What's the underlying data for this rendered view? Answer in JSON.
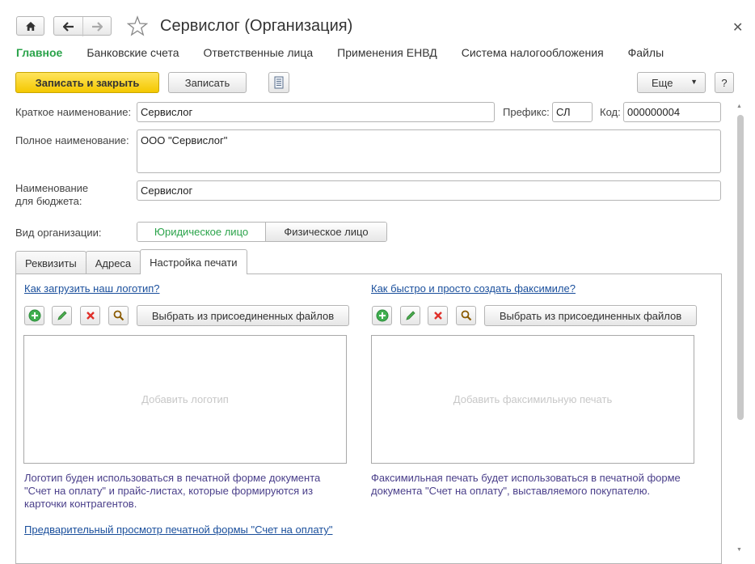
{
  "window": {
    "title": "Сервислог (Организация)"
  },
  "sections": [
    {
      "label": "Главное",
      "active": true
    },
    {
      "label": "Банковские счета",
      "active": false
    },
    {
      "label": "Ответственные лица",
      "active": false
    },
    {
      "label": "Применения ЕНВД",
      "active": false
    },
    {
      "label": "Система налогообложения",
      "active": false
    },
    {
      "label": "Файлы",
      "active": false
    }
  ],
  "toolbar": {
    "save_close_label": "Записать и закрыть",
    "save_label": "Записать",
    "more_label": "Еще",
    "help_label": "?"
  },
  "form": {
    "short_name_label": "Краткое наименование:",
    "short_name_value": "Сервислог",
    "prefix_label": "Префикс:",
    "prefix_value": "СЛ",
    "code_label": "Код:",
    "code_value": "000000004",
    "full_name_label": "Полное наименование:",
    "full_name_value": "ООО \"Сервислог\"",
    "budget_name_label_1": "Наименование",
    "budget_name_label_2": "для бюджета:",
    "budget_name_value": "Сервислог",
    "org_type_label": "Вид организации:",
    "org_type_options": [
      "Юридическое лицо",
      "Физическое лицо"
    ],
    "org_type_selected": "Юридическое лицо"
  },
  "tabs": [
    {
      "label": "Реквизиты",
      "active": false
    },
    {
      "label": "Адреса",
      "active": false
    },
    {
      "label": "Настройка печати",
      "active": true
    }
  ],
  "print_settings": {
    "logo": {
      "help_link": "Как загрузить наш логотип?",
      "choose_button": "Выбрать из присоединенных файлов",
      "placeholder": "Добавить логотип",
      "note_line1": "Логотип буден использоваться в печатной форме документа",
      "note_line2": "\"Счет на оплату\" и прайс-листах, которые формируются из",
      "note_line3": "карточки контрагентов."
    },
    "facsimile": {
      "help_link": "Как быстро и просто создать факсимиле?",
      "choose_button": "Выбрать из присоединенных файлов",
      "placeholder": "Добавить факсимильную печать",
      "note_line1": "Факсимильная печать будет использоваться в печатной форме",
      "note_line2": "документа \"Счет на оплату\", выставляемого покупателю."
    },
    "preview_link": "Предварительный просмотр печатной формы \"Счет на оплату\""
  },
  "colors": {
    "accent_green": "#2aa34a",
    "primary_yellow": "#f4c800",
    "link_blue": "#1a4f9c"
  }
}
